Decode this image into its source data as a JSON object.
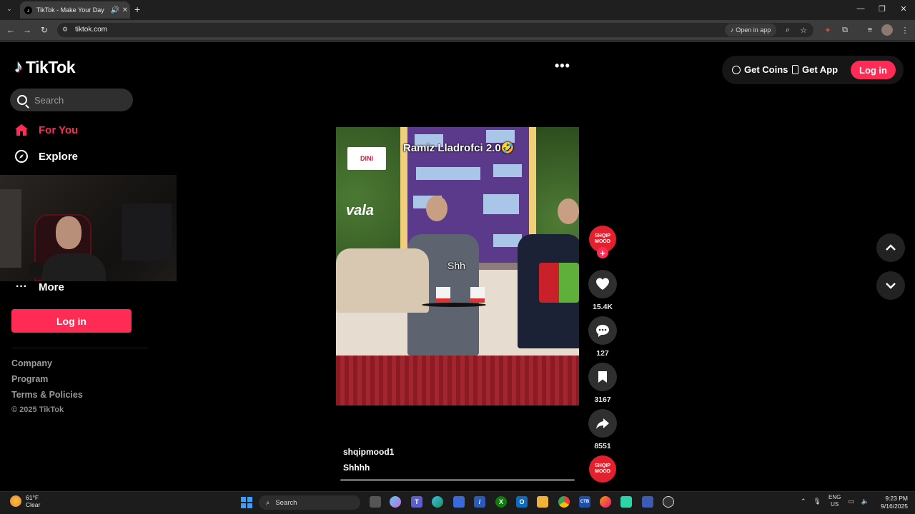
{
  "browser": {
    "tab_title": "TikTok - Make Your Day",
    "url": "tiktok.com",
    "open_in_app": "Open in app"
  },
  "sidebar": {
    "logo_text": "TikTok",
    "search_placeholder": "Search",
    "nav": [
      {
        "label": "For You",
        "icon": "home-icon",
        "active": true
      },
      {
        "label": "Explore",
        "icon": "compass-icon"
      },
      {
        "label": "More",
        "icon": "more-dots-icon"
      }
    ],
    "login_label": "Log in",
    "footer": {
      "company": "Company",
      "program": "Program",
      "terms": "Terms & Policies",
      "copyright": "© 2025 TikTok"
    }
  },
  "header": {
    "get_coins": "Get Coins",
    "get_app": "Get App",
    "login_label": "Log in"
  },
  "video": {
    "overlay_title": "Ramiz Lladrofci 2.0🤣",
    "overlay_sub": "Shh",
    "sponsor_left": "DINI",
    "sponsor_logo": "vala",
    "author_avatar": "SHQIP MOOD",
    "username": "shqipmood1",
    "caption": "Shhhh",
    "actions": {
      "likes": "15.4K",
      "comments": "127",
      "saves": "3167",
      "shares": "8551"
    },
    "progress": 0.0
  },
  "taskbar": {
    "weather_temp": "61°F",
    "weather_desc": "Clear",
    "search_label": "Search",
    "lang_top": "ENG",
    "lang_bottom": "US",
    "time": "9:23 PM",
    "date": "9/16/2025"
  },
  "colors": {
    "accent": "#fe2c55",
    "background": "#000000"
  }
}
